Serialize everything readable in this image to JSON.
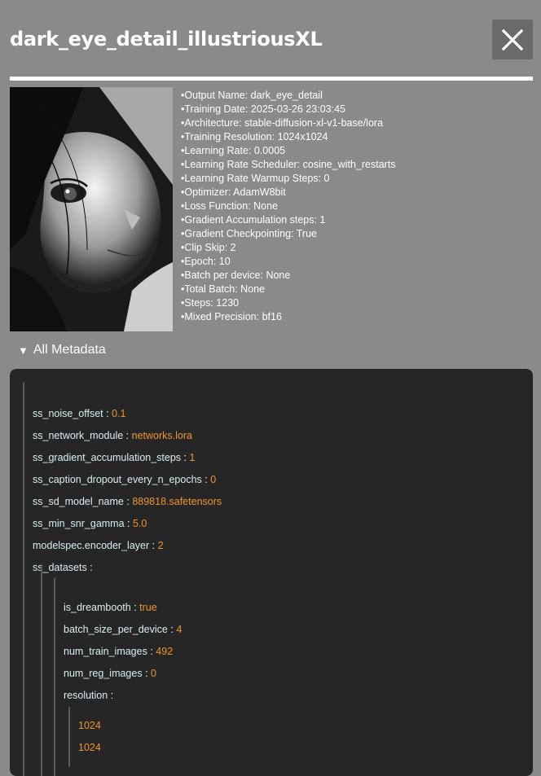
{
  "header": {
    "title": "dark_eye_detail_illustriousXL"
  },
  "info_items": [
    "Output Name: dark_eye_detail",
    "Training Date: 2025-03-26 23:03:45",
    "Architecture: stable-diffusion-xl-v1-base/lora",
    "Training Resolution: 1024x1024",
    "Learning Rate: 0.0005",
    "Learning Rate Scheduler: cosine_with_restarts",
    "Learning Rate Warmup Steps: 0",
    "Optimizer: AdamW8bit",
    "Loss Function: None",
    "Gradient Accumulation steps: 1",
    "Gradient Checkpointing: True",
    "Clip Skip: 2",
    "Epoch: 10",
    "Batch per device: None",
    "Total Batch: None",
    "Steps: 1230",
    "Mixed Precision: bf16"
  ],
  "metadata_toggle": {
    "arrow": "▼",
    "label": "All Metadata"
  },
  "metadata": {
    "separator": ":",
    "top": [
      {
        "key": "ss_noise_offset",
        "value": "0.1"
      },
      {
        "key": "ss_network_module",
        "value": "networks.lora"
      },
      {
        "key": "ss_gradient_accumulation_steps",
        "value": "1"
      },
      {
        "key": "ss_caption_dropout_every_n_epochs",
        "value": "0"
      },
      {
        "key": "ss_sd_model_name",
        "value": "889818.safetensors"
      },
      {
        "key": "ss_min_snr_gamma",
        "value": "5.0"
      },
      {
        "key": "modelspec.encoder_layer",
        "value": "2"
      },
      {
        "key": "ss_datasets",
        "value": ""
      }
    ],
    "dataset": [
      {
        "key": "is_dreambooth",
        "value": "true"
      },
      {
        "key": "batch_size_per_device",
        "value": "4"
      },
      {
        "key": "num_train_images",
        "value": "492"
      },
      {
        "key": "num_reg_images",
        "value": "0"
      },
      {
        "key": "resolution",
        "value": ""
      }
    ],
    "resolution_values": [
      "1024",
      "1024"
    ]
  },
  "colors": {
    "background": "#8a8a8a",
    "panel": "#262626",
    "key": "#d8eef2",
    "value": "#f0932f"
  }
}
